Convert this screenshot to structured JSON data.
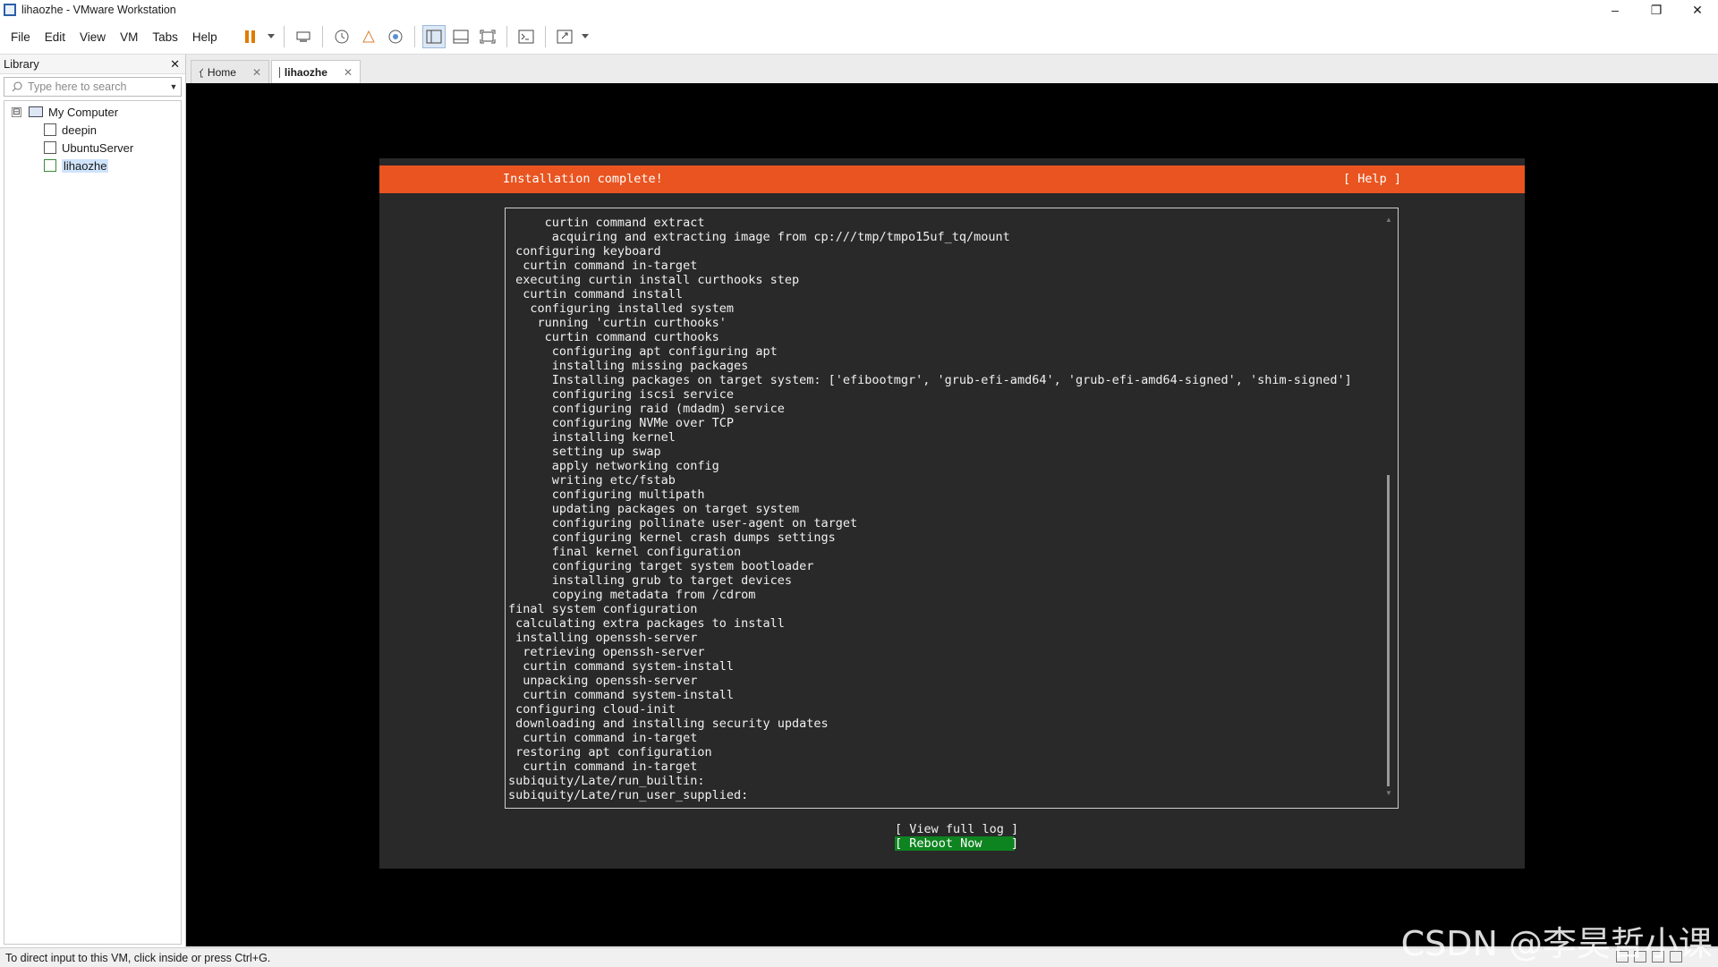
{
  "window": {
    "title": "lihaozhe - VMware Workstation",
    "minimize": "–",
    "maximize": "❐",
    "close": "✕"
  },
  "menu": [
    "File",
    "Edit",
    "View",
    "VM",
    "Tabs",
    "Help"
  ],
  "toolbar": {
    "icons": [
      "pause-icon",
      "dropdown-icon",
      "send-ctrl-alt-del-icon",
      "snapshot-icon",
      "revert-snapshot-icon",
      "snapshot-manager-icon",
      "show-library-icon",
      "thumbnail-bar-icon",
      "full-screen-icon",
      "console-view-icon",
      "stretch-guest-icon"
    ]
  },
  "library": {
    "title": "Library",
    "close": "✕",
    "search_placeholder": "Type here to search",
    "root": "My Computer",
    "root_toggle": "⊟",
    "vms": [
      "deepin",
      "UbuntuServer",
      "lihaozhe"
    ],
    "selected": "lihaozhe"
  },
  "tabs": [
    {
      "label": "Home",
      "close": "✕"
    },
    {
      "label": "lihaozhe",
      "close": "✕"
    }
  ],
  "installer": {
    "header": "Installation complete!",
    "help": "[ Help ]",
    "log_lines": [
      "     curtin command extract",
      "      acquiring and extracting image from cp:///tmp/tmpo15uf_tq/mount",
      " configuring keyboard",
      "  curtin command in-target",
      " executing curtin install curthooks step",
      "  curtin command install",
      "   configuring installed system",
      "    running 'curtin curthooks'",
      "     curtin command curthooks",
      "      configuring apt configuring apt",
      "      installing missing packages",
      "      Installing packages on target system: ['efibootmgr', 'grub-efi-amd64', 'grub-efi-amd64-signed', 'shim-signed']",
      "      configuring iscsi service",
      "      configuring raid (mdadm) service",
      "      configuring NVMe over TCP",
      "      installing kernel",
      "      setting up swap",
      "      apply networking config",
      "      writing etc/fstab",
      "      configuring multipath",
      "      updating packages on target system",
      "      configuring pollinate user-agent on target",
      "      configuring kernel crash dumps settings",
      "      final kernel configuration",
      "      configuring target system bootloader",
      "      installing grub to target devices",
      "      copying metadata from /cdrom",
      "final system configuration",
      " calculating extra packages to install",
      " installing openssh-server",
      "  retrieving openssh-server",
      "  curtin command system-install",
      "  unpacking openssh-server",
      "  curtin command system-install",
      " configuring cloud-init",
      " downloading and installing security updates",
      "  curtin command in-target",
      " restoring apt configuration",
      "  curtin command in-target",
      "subiquity/Late/run_builtin:",
      "subiquity/Late/run_user_supplied:"
    ],
    "scroll_up": "▲",
    "scroll_down": "▼",
    "view_full_log": "[ View full log ]",
    "reboot_now": "[ Reboot Now    ]"
  },
  "status": {
    "message": "To direct input to this VM, click inside or press Ctrl+G."
  },
  "watermark": "CSDN @李昊哲小课",
  "colors": {
    "accent_orange": "#e95420",
    "reboot_green": "#0e8420",
    "terminal_bg": "#292929"
  }
}
